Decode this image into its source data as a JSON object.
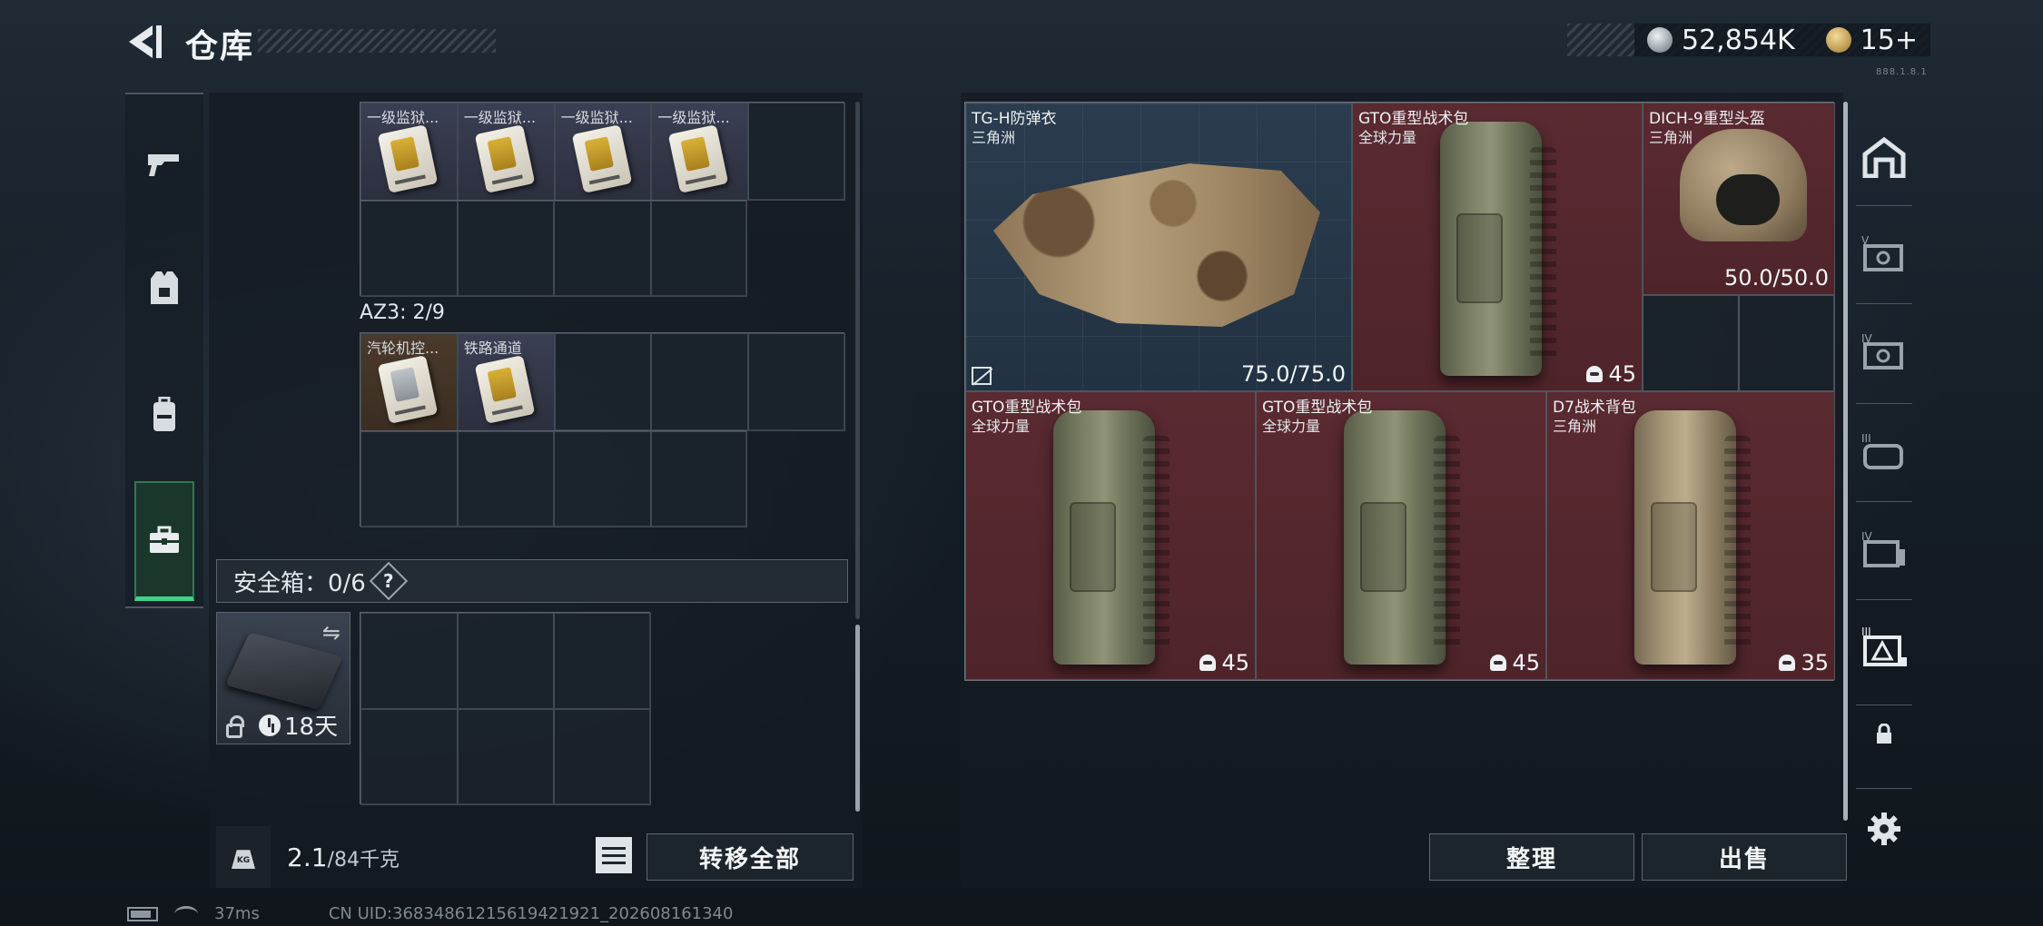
{
  "header": {
    "title": "仓库",
    "currency_silver": "52,854K",
    "currency_gold": "15+",
    "tiny_code": "888.1.8.1"
  },
  "left_nav": {
    "items": [
      "weapons-tab",
      "armor-tab",
      "backpack-tab",
      "safe-case-tab"
    ],
    "active": "safe-case-tab"
  },
  "container": {
    "top_grid_labels": [
      "一级监狱...",
      "一级监狱...",
      "一级监狱...",
      "一级监狱..."
    ],
    "az3_label": "AZ3: 2/9",
    "az3_items": [
      "汽轮机控...",
      "铁路通道"
    ]
  },
  "safe": {
    "label": "安全箱：0/6",
    "help": "?",
    "duration": "18天"
  },
  "footer_left": {
    "weight_current": "2.1",
    "weight_max": "/84千克",
    "transfer_all": "转移全部"
  },
  "storage": {
    "items": [
      {
        "name": "TG-H防弹衣",
        "sub": "三角洲",
        "value": "75.0/75.0",
        "bg": "blue"
      },
      {
        "name": "GTO重型战术包",
        "sub": "全球力量",
        "value": "45",
        "bg": "red"
      },
      {
        "name": "DICH-9重型头盔",
        "sub": "三角洲",
        "value": "50.0/50.0",
        "bg": "red"
      },
      {
        "name": "GTO重型战术包",
        "sub": "全球力量",
        "value": "45",
        "bg": "red"
      },
      {
        "name": "GTO重型战术包",
        "sub": "全球力量",
        "value": "45",
        "bg": "red"
      },
      {
        "name": "D7战术背包",
        "sub": "三角洲",
        "value": "35",
        "bg": "red"
      }
    ],
    "sort_button": "整理",
    "sell_button": "出售"
  },
  "right_nav": {
    "items": [
      "safe-house-icon",
      "tier-v-storage-icon",
      "tier-iv-storage-icon",
      "tier-iii-storage-icon",
      "tier-iv-bag-icon",
      "tier-iii-warning-icon",
      "locked-slot-icon",
      "settings-icon"
    ]
  },
  "status_bar": {
    "ping": "37ms",
    "uid": "CN UID:36834861215619421921_202608161340"
  }
}
